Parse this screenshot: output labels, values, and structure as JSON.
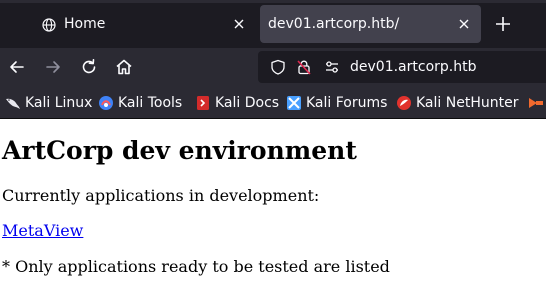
{
  "tabs": [
    {
      "label": "Home",
      "icon": "globe-icon",
      "active": false
    },
    {
      "label": "dev01.artcorp.htb/",
      "active": true
    }
  ],
  "urlbar": {
    "url": "dev01.artcorp.htb"
  },
  "bookmarks": [
    {
      "label": "Kali Linux",
      "icon": "kali-dragon-icon",
      "color": "#2f2f2f"
    },
    {
      "label": "Kali Tools",
      "icon": "kali-tools-icon",
      "color": "#3f82f7"
    },
    {
      "label": "Kali Docs",
      "icon": "kali-docs-icon",
      "color": "#d32b2b"
    },
    {
      "label": "Kali Forums",
      "icon": "kali-forums-icon",
      "color": "#4aa0ff"
    },
    {
      "label": "Kali NetHunter",
      "icon": "nethunter-icon",
      "color": "#e2322d"
    }
  ],
  "page": {
    "heading": "ArtCorp dev environment",
    "intro": "Currently applications in development:",
    "app_link": "MetaView",
    "note": "* Only applications ready to be tested are listed"
  },
  "colors": {
    "tabstrip_bg": "#1c1b22",
    "toolbar_bg": "#2b2a33",
    "active_tab_bg": "#42414d",
    "text_light": "#fbfbfe",
    "link": "#0000ee"
  }
}
